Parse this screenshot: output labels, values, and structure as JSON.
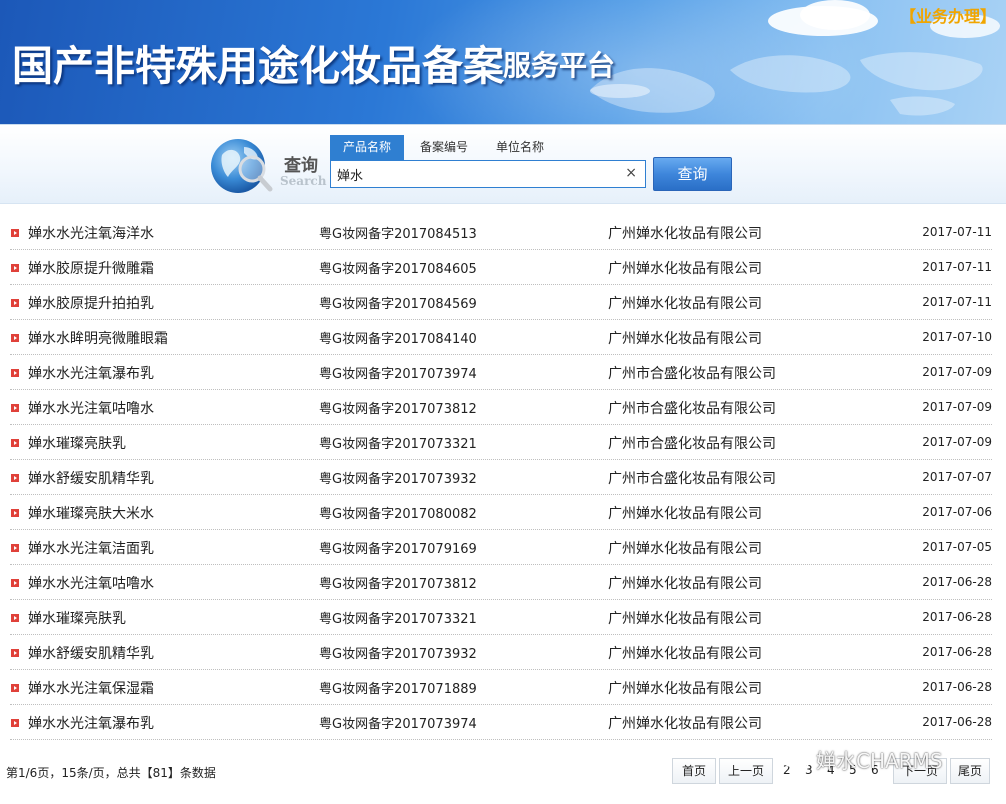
{
  "header": {
    "title": "国产非特殊用途化妆品备案",
    "subtitle": "服务平台",
    "business_link": "【业务办理】"
  },
  "search": {
    "label": "查询",
    "label_en": "Search",
    "tabs": [
      "产品名称",
      "备案编号",
      "单位名称"
    ],
    "active_tab": "产品名称",
    "query": "婵水",
    "clear_symbol": "×",
    "button_label": "查询"
  },
  "results": [
    {
      "name": "婵水水光注氧海洋水",
      "code": "粤G妆网备字2017084513",
      "company": "广州婵水化妆品有限公司",
      "date": "2017-07-11"
    },
    {
      "name": "婵水胶原提升微雕霜",
      "code": "粤G妆网备字2017084605",
      "company": "广州婵水化妆品有限公司",
      "date": "2017-07-11"
    },
    {
      "name": "婵水胶原提升拍拍乳",
      "code": "粤G妆网备字2017084569",
      "company": "广州婵水化妆品有限公司",
      "date": "2017-07-11"
    },
    {
      "name": "婵水水眸明亮微雕眼霜",
      "code": "粤G妆网备字2017084140",
      "company": "广州婵水化妆品有限公司",
      "date": "2017-07-10"
    },
    {
      "name": "婵水水光注氧瀑布乳",
      "code": "粤G妆网备字2017073974",
      "company": "广州市合盛化妆品有限公司",
      "date": "2017-07-09"
    },
    {
      "name": "婵水水光注氧咕噜水",
      "code": "粤G妆网备字2017073812",
      "company": "广州市合盛化妆品有限公司",
      "date": "2017-07-09"
    },
    {
      "name": "婵水璀璨亮肤乳",
      "code": "粤G妆网备字2017073321",
      "company": "广州市合盛化妆品有限公司",
      "date": "2017-07-09"
    },
    {
      "name": "婵水舒缓安肌精华乳",
      "code": "粤G妆网备字2017073932",
      "company": "广州市合盛化妆品有限公司",
      "date": "2017-07-07"
    },
    {
      "name": "婵水璀璨亮肤大米水",
      "code": "粤G妆网备字2017080082",
      "company": "广州婵水化妆品有限公司",
      "date": "2017-07-06"
    },
    {
      "name": "婵水水光注氧洁面乳",
      "code": "粤G妆网备字2017079169",
      "company": "广州婵水化妆品有限公司",
      "date": "2017-07-05"
    },
    {
      "name": "婵水水光注氧咕噜水",
      "code": "粤G妆网备字2017073812",
      "company": "广州婵水化妆品有限公司",
      "date": "2017-06-28"
    },
    {
      "name": "婵水璀璨亮肤乳",
      "code": "粤G妆网备字2017073321",
      "company": "广州婵水化妆品有限公司",
      "date": "2017-06-28"
    },
    {
      "name": "婵水舒缓安肌精华乳",
      "code": "粤G妆网备字2017073932",
      "company": "广州婵水化妆品有限公司",
      "date": "2017-06-28"
    },
    {
      "name": "婵水水光注氧保湿霜",
      "code": "粤G妆网备字2017071889",
      "company": "广州婵水化妆品有限公司",
      "date": "2017-06-28"
    },
    {
      "name": "婵水水光注氧瀑布乳",
      "code": "粤G妆网备字2017073974",
      "company": "广州婵水化妆品有限公司",
      "date": "2017-06-28"
    }
  ],
  "pagination": {
    "info": "第1/6页，15条/页，总共【81】条数据",
    "first": "首页",
    "prev": "上一页",
    "pages": [
      "2",
      "3",
      "4",
      "5",
      "6"
    ],
    "next": "下一页",
    "last": "尾页"
  },
  "watermark": {
    "text": "婵水CHARMS"
  },
  "colors": {
    "banner_blue": "#2b78d6",
    "accent_blue": "#2f7fd1",
    "link_orange": "#f0a500",
    "bullet_red": "#e0413a"
  }
}
